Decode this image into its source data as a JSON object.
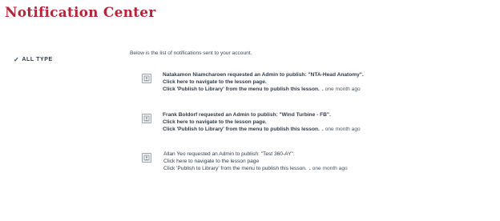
{
  "header": {
    "title": "Notification Center"
  },
  "filter": {
    "label": "ALL TYPE",
    "icon": "check-icon"
  },
  "intro": "Below is the list of notifications sent to your account.",
  "notifications": [
    {
      "line1": "Natakamon Niamcharoen requested an Admin to publish: \"NTA-Head Anatomy\".",
      "line2": "Click here to navigate to the lesson page.",
      "line3": "Click 'Publish to Library' from the menu to publish this lesson.",
      "time": "one month ago",
      "unread": true,
      "icon": "lesson-icon"
    },
    {
      "line1": "Frank Boldorf requested an Admin to publish: \"Wind Turbine - FB\".",
      "line2": "Click here to navigate to the lesson page.",
      "line3": "Click 'Publish to Library' from the menu to publish this lesson.",
      "time": "one month ago",
      "unread": true,
      "icon": "lesson-icon"
    },
    {
      "line1": "Allan Yeo requested an Admin to publish: \"Test 360-AY\".",
      "line2": "Click here to navigate to the lesson page",
      "line3": "Click 'Publish to Library' from the menu to publish this lesson.",
      "time": "one month ago",
      "unread": false,
      "icon": "lesson-icon"
    }
  ]
}
